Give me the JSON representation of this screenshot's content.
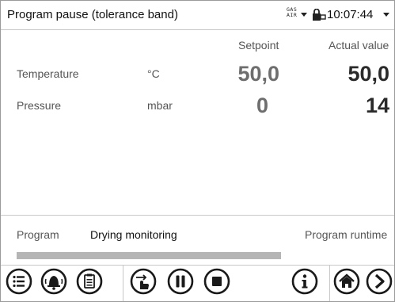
{
  "header": {
    "title": "Program pause (tolerance band)",
    "gas_label_line1": "GAS",
    "gas_label_line2": "AIR",
    "time": "10:07:44"
  },
  "columns": {
    "setpoint": "Setpoint",
    "actual": "Actual value"
  },
  "rows": [
    {
      "name": "Temperature",
      "unit": "°C",
      "setpoint": "50,0",
      "actual": "50,0"
    },
    {
      "name": "Pressure",
      "unit": "mbar",
      "setpoint": "0",
      "actual": "14"
    }
  ],
  "program": {
    "label": "Program",
    "name": "Drying monitoring",
    "runtime_label": "Program runtime",
    "progress": 0.7
  },
  "toolbar": {
    "icons": [
      "menu-list-icon",
      "alarm-bell-icon",
      "clipboard-icon",
      "hand-pointer-icon",
      "pause-icon",
      "stop-icon",
      "info-icon",
      "home-icon",
      "next-arrow-icon"
    ]
  },
  "colors": {
    "accent": "#2a2a2a",
    "progress": "#b5b5b5"
  }
}
